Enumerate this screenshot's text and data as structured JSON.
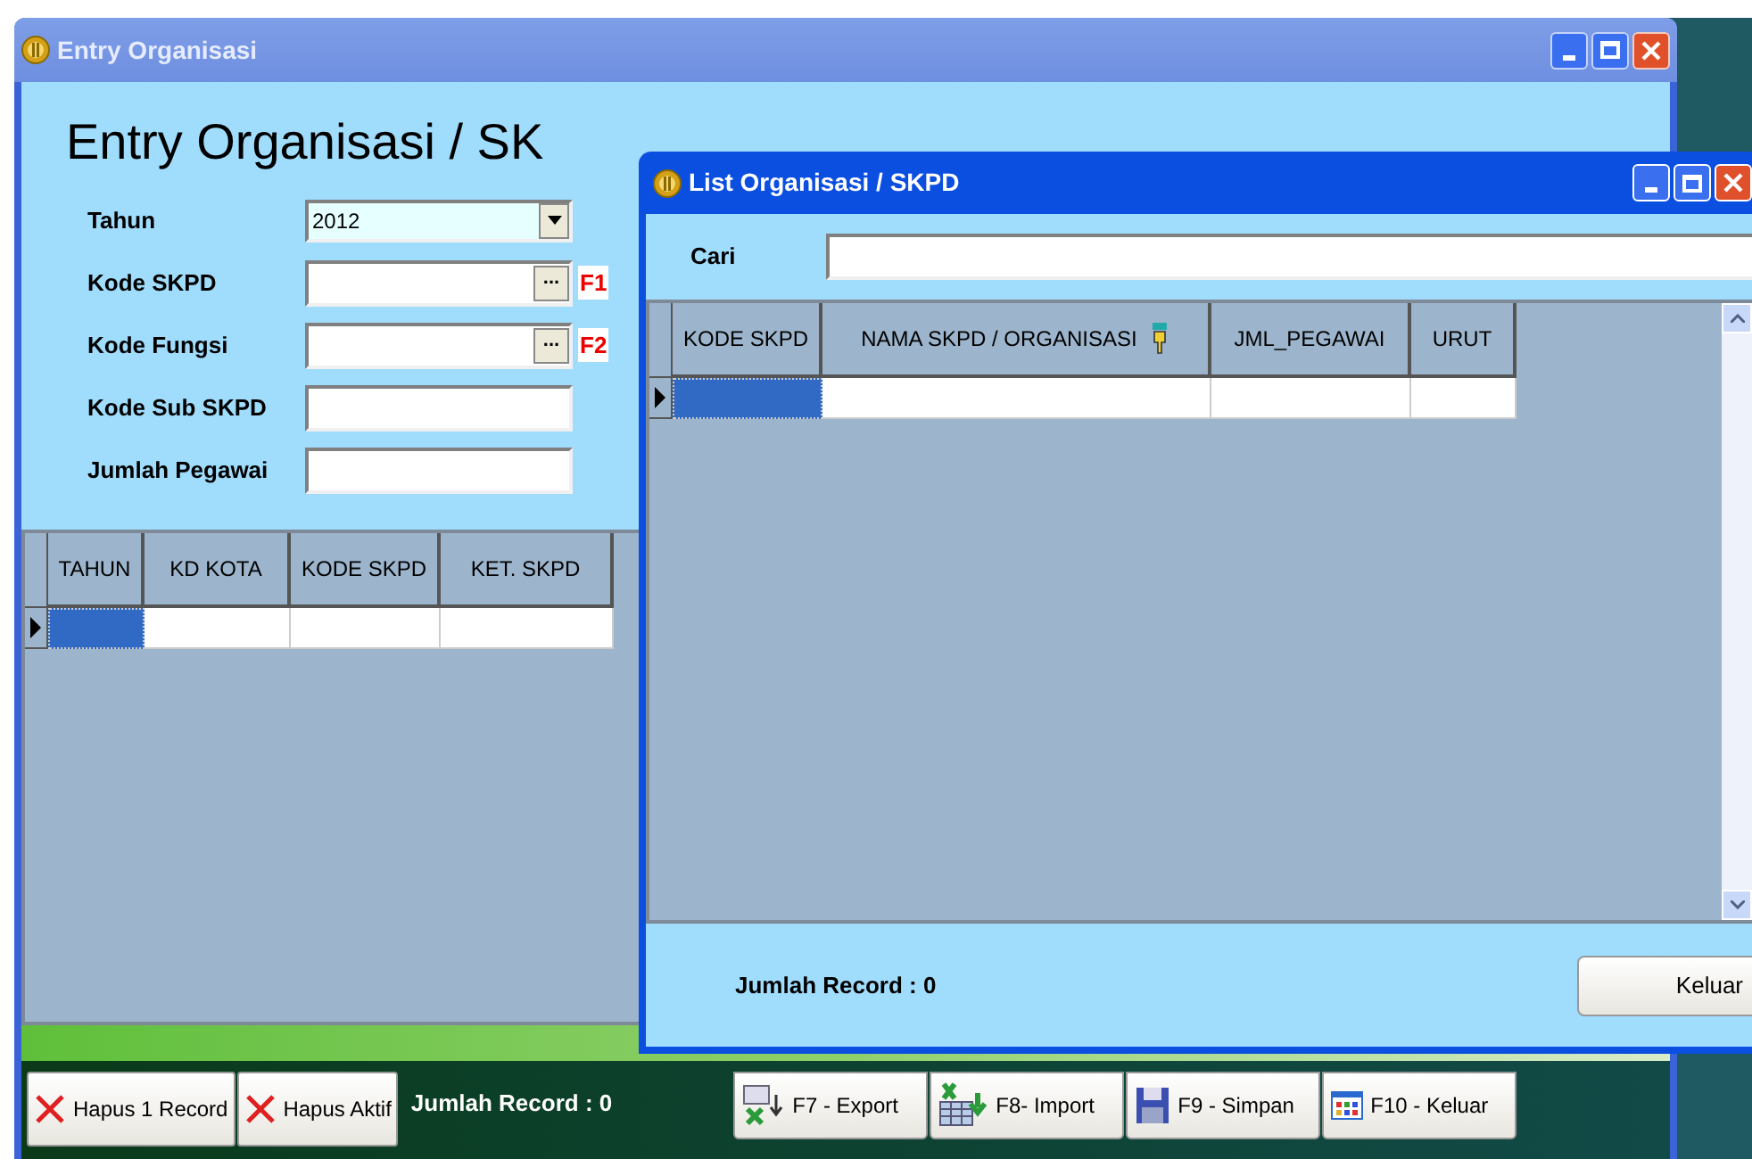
{
  "main_window": {
    "title": "Entry Organisasi",
    "heading": "Entry Organisasi / SK",
    "fields": [
      {
        "label": "Tahun",
        "kind": "dropdown",
        "value": "2012"
      },
      {
        "label": "Kode SKPD",
        "kind": "lookup",
        "button": "...",
        "shortcut": "F1"
      },
      {
        "label": "Kode Fungsi",
        "kind": "lookup",
        "button": "...",
        "shortcut": "F2"
      },
      {
        "label": "Kode Sub SKPD",
        "kind": "text"
      },
      {
        "label": "Jumlah Pegawai",
        "kind": "text"
      }
    ],
    "grid": {
      "columns": [
        {
          "label": "TAHUN",
          "sort_icon": false
        },
        {
          "label": "KD KOTA",
          "sort_icon": false
        },
        {
          "label": "KODE SKPD",
          "sort_icon": false
        },
        {
          "label": "KET. SKPD",
          "sort_icon": false
        }
      ],
      "rows": [
        {
          "selected": true
        }
      ]
    },
    "buttons": [
      {
        "label": "Hapus 1 Record",
        "kind": "delete"
      },
      {
        "label": "Hapus Aktif",
        "kind": "delete"
      }
    ],
    "record_count": "Jumlah Record : 0",
    "function_buttons": [
      {
        "label": "F7 - Export",
        "kind": "export"
      },
      {
        "label": "F8- Import",
        "kind": "import"
      },
      {
        "label": "F9 - Simpan",
        "kind": "save"
      },
      {
        "label": "F10 - Keluar",
        "kind": "exit"
      }
    ]
  },
  "dialog": {
    "title": "List Organisasi / SKPD",
    "search_label": "Cari",
    "grid": {
      "columns": [
        {
          "label": "KODE SKPD",
          "sort_icon": false
        },
        {
          "label": "NAMA SKPD / ORGANISASI",
          "sort_icon": true
        },
        {
          "label": "JML_PEGAWAI",
          "sort_icon": false
        },
        {
          "label": "URUT",
          "sort_icon": false
        }
      ],
      "rows": [
        {
          "selected": true
        }
      ]
    },
    "record_count": "Jumlah Record : 0",
    "close_button": "Keluar"
  }
}
